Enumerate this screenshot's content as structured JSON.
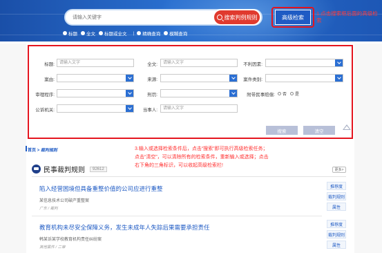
{
  "search": {
    "placeholder": "请输入关键字",
    "search_button": "搜索判例规则",
    "advanced_button": "高级检索",
    "modes": [
      "标题",
      "全文",
      "标题或全文"
    ],
    "match_modes": [
      "精确查询",
      "模糊查询"
    ],
    "separator": "|"
  },
  "annotations": {
    "note1": "1.点击搜索框后面的高级检索",
    "note3_lines": [
      "3.输入或选择检索条件后，点击“搜索”即可执行高级检索任务；",
      "点击“清空”，可以清除所有的检索条件，重新输入或选择；点击",
      "右下角的三角标识，可以收起高级检索栏!"
    ]
  },
  "advanced_panel": {
    "fields": {
      "title_label": "标题:",
      "title_placeholder": "请输入文字",
      "fulltext_label": "全文:",
      "fulltext_placeholder": "请输入文字",
      "bad_factor_label": "不利因素:",
      "cause_label": "案由:",
      "source_label": "来源:",
      "case_type_label": "案件类别:",
      "procedure_label": "审理程序:",
      "criminal_label": "刑罚:",
      "attached_civil_label": "附带民事赔偿:",
      "attached_civil_no": "否",
      "attached_civil_yes": "是",
      "prosecutor_label": "公诉机关:",
      "party_label": "当事人:",
      "party_placeholder": "请输入文字"
    },
    "search_button": "搜索",
    "clear_button": "清空"
  },
  "breadcrumb": {
    "home": "首页",
    "sep": ">",
    "current": "裁判规则"
  },
  "section": {
    "title": "民事裁判规则",
    "count": "92612",
    "more": "更多>"
  },
  "results": [
    {
      "title": "陷入经营困境但具备重整价值的公司应进行重整",
      "subtitle": "某信息技术公司破产重整案",
      "meta": "广东 / 裁判",
      "tags": [
        "推荐度",
        "裁判规则",
        "属性"
      ]
    },
    {
      "title": "教育机构未尽安全保障义务，发生未成年人失踪后果需要承担责任",
      "subtitle": "韩某诉某学校教育机构责任纠纷案",
      "meta": "其他案件 / 二审",
      "tags": [
        "推荐度",
        "裁判规则",
        "属性"
      ]
    }
  ],
  "colors": {
    "banner": "#2a6fcf",
    "accent_red": "#e03a2e",
    "highlight": "#e4141e",
    "link_blue": "#1f5bc4"
  }
}
